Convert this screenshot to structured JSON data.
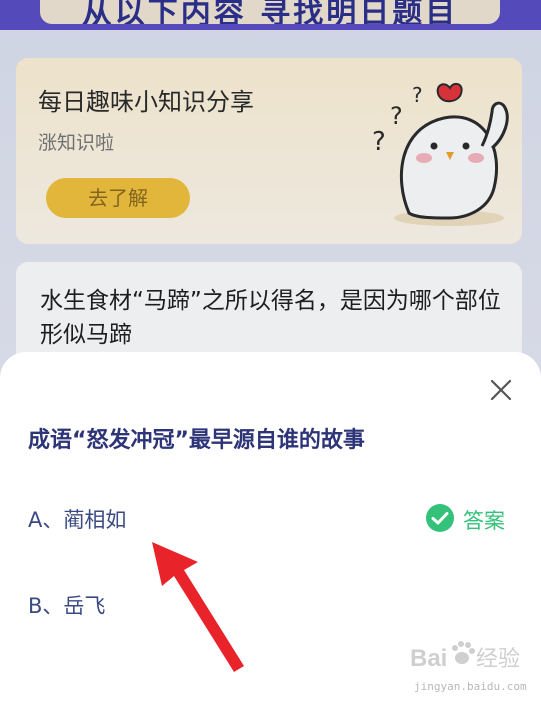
{
  "background_page": {
    "banner": "从以下内容 寻找明日题目",
    "fact_card": {
      "title": "每日趣味小知识分享",
      "subtitle": "涨知识啦",
      "button_label": "去了解"
    },
    "question_card": {
      "text": "水生食材“马蹄”之所以得名，是因为哪个部位形似马蹄"
    }
  },
  "sheet": {
    "question": "成语“怒发冲冠”最早源自谁的故事",
    "options": [
      {
        "label": "A、蔺相如",
        "is_answer": true,
        "answer_label": "答案"
      },
      {
        "label": "B、岳飞",
        "is_answer": false
      }
    ],
    "close_icon": "close-icon"
  },
  "watermark": {
    "logo": "Baidu 经验",
    "url": "jingyan.baidu.com"
  },
  "colors": {
    "title": "#2d3477",
    "option_text": "#3c4a82",
    "answer_green": "#34c27a",
    "arrow_red": "#e8242a",
    "button_yellow": "#f4c23c"
  }
}
